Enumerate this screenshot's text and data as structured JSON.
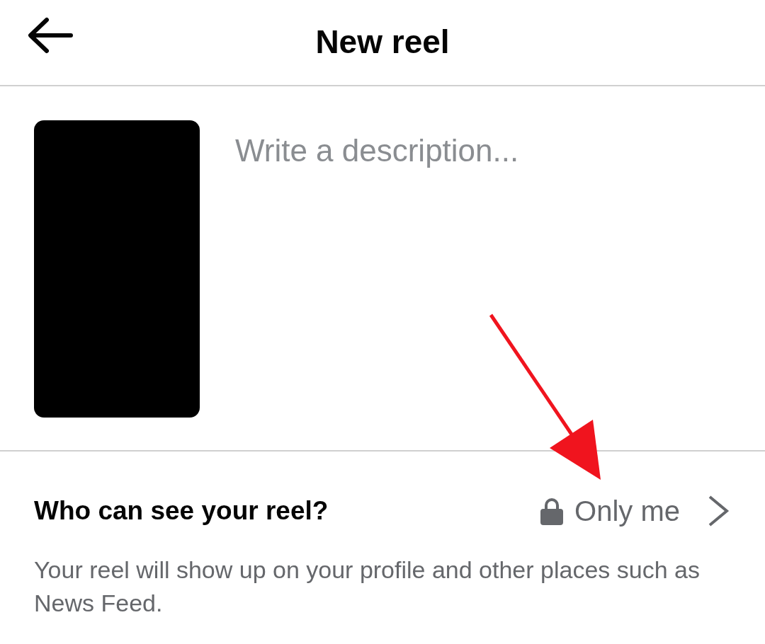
{
  "header": {
    "title": "New reel"
  },
  "description_field": {
    "placeholder": "Write a description..."
  },
  "privacy": {
    "label": "Who can see your reel?",
    "value": "Only me",
    "help_text": "Your reel will show up on your profile and other places such as News Feed."
  }
}
